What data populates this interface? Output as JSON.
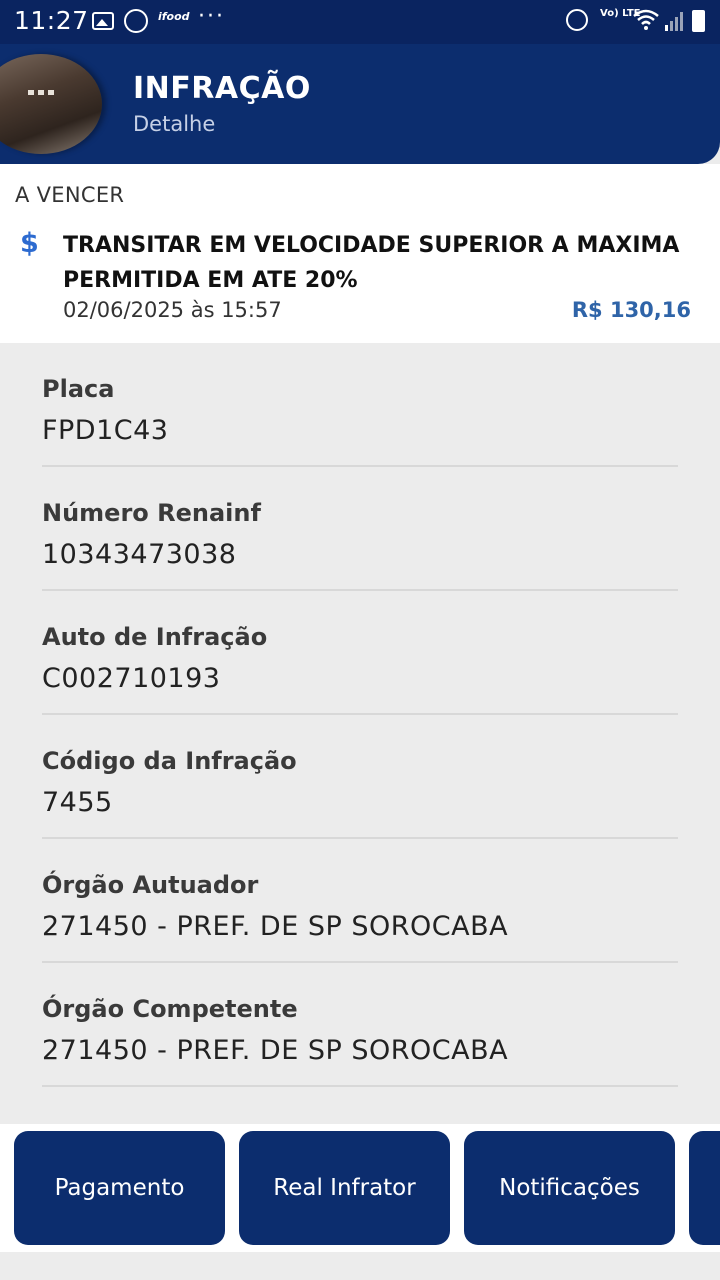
{
  "status_bar": {
    "time": "11:27",
    "icons": [
      "gallery-icon",
      "whatsapp-icon",
      "ifood-icon",
      "more-dots-icon",
      "alarm-icon",
      "volte-icon",
      "wifi-icon",
      "signal-icon",
      "battery-icon"
    ],
    "ifood_text": "ifood",
    "volte_text": "Vo) LTE"
  },
  "header": {
    "title": "INFRAÇÃO",
    "subtitle": "Detalhe"
  },
  "summary": {
    "status": "A VENCER",
    "title": "TRANSITAR EM VELOCIDADE SUPERIOR A MAXIMA PERMITIDA EM ATE 20%",
    "datetime": "02/06/2025 às 15:57",
    "amount": "R$ 130,16",
    "icon": "dollar-icon",
    "accent_color": "#2f64a8"
  },
  "details": [
    {
      "label": "Placa",
      "value": "FPD1C43"
    },
    {
      "label": "Número Renainf",
      "value": "10343473038"
    },
    {
      "label": "Auto de Infração",
      "value": "C002710193"
    },
    {
      "label": "Código da Infração",
      "value": "7455"
    },
    {
      "label": "Órgão Autuador",
      "value": "271450 - PREF. DE SP SOROCABA"
    },
    {
      "label": "Órgão Competente",
      "value": "271450 - PREF. DE SP SOROCABA"
    }
  ],
  "actions": {
    "payment": "Pagamento",
    "real_offender": "Real Infrator",
    "notifications": "Notificações"
  },
  "colors": {
    "primary": "#0c2d6e",
    "background": "#ececec"
  }
}
